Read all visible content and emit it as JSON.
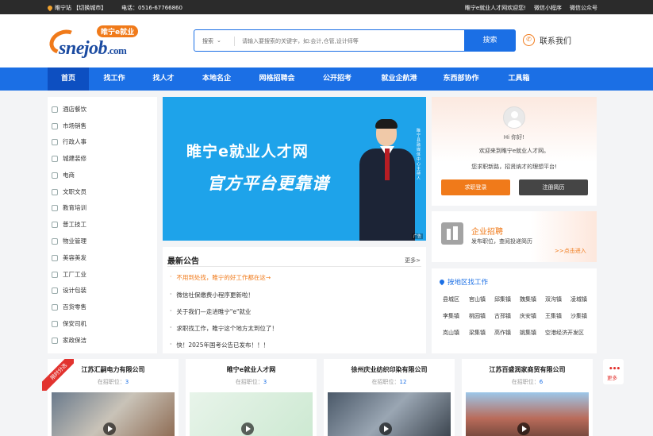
{
  "topbar": {
    "location": "睢宁站 【切换城市】",
    "phone": "电话：0516-67766860",
    "welcome": "睢宁e就业人才网欢迎您!",
    "miniprogram": "微信小程序",
    "official_account": "微信公众号"
  },
  "header": {
    "logo_tag": "睢宁e就业",
    "logo_word": "snejob",
    "logo_com": ".com",
    "search_scope": "搜索",
    "search_placeholder": "请输入要搜索的关键字，如:会计,仓管,设计师等",
    "search_button": "搜索",
    "contact": "联系我们"
  },
  "nav": [
    "首页",
    "找工作",
    "找人才",
    "本地名企",
    "网格招聘会",
    "公开招考",
    "就业企航港",
    "东西部协作",
    "工具箱"
  ],
  "categories": [
    "酒店餐饮",
    "市场销售",
    "行政人事",
    "城建装修",
    "电商",
    "文职文员",
    "教育培训",
    "普工技工",
    "物业管理",
    "美容美发",
    "工厂工业",
    "设计包装",
    "百货零售",
    "保安司机",
    "家政保洁"
  ],
  "banner": {
    "title": "睢宁e就业人才网",
    "subtitle": "官方平台更靠谱",
    "vertical_text": "睢宁县融媒体中心主持人",
    "corner": "广告"
  },
  "notice": {
    "title": "最新公告",
    "more": "更多>",
    "items": [
      "不用到处找，睢宁的好工作都在这→",
      "微信社保缴费小程序更新啦！",
      "关于我们—走进睢宁\"e\"就业",
      "求职找工作，睢宁这个地方太到位了！",
      "快！2025年国考公告已发布！！！"
    ]
  },
  "login": {
    "hi": "Hi 你好!",
    "welcome": "欢迎来到睢宁e就业人才网。",
    "tip": "您求职新路，招贤纳才的理想平台!",
    "login_button": "求职登录",
    "register_button": "注册简历"
  },
  "enterprise": {
    "title": "企业招聘",
    "desc": "发布职位，查阅投递简历",
    "go": ">>点击进入"
  },
  "area": {
    "title": "按地区找工作",
    "towns": [
      "县城区",
      "官山镇",
      "邱集镇",
      "魏集镇",
      "双沟镇",
      "凌城镇",
      "李集镇",
      "桃园镇",
      "古邳镇",
      "庆安镇",
      "王集镇",
      "沙集镇",
      "岚山镇",
      "梁集镇",
      "高作镇",
      "姚集镇",
      "空港经济开发区"
    ]
  },
  "ribbon": "限时分选",
  "companies": [
    {
      "name": "江苏汇嗣电力有限公司",
      "label": "在招职位：",
      "count": "3"
    },
    {
      "name": "睢宁e就业人才网",
      "label": "在招职位：",
      "count": "3"
    },
    {
      "name": "徐州庆业纺织印染有限公司",
      "label": "在招职位：",
      "count": "12"
    },
    {
      "name": "江苏百盛润家商贸有限公司",
      "label": "在招职位：",
      "count": "6"
    }
  ],
  "float_more": "更多"
}
